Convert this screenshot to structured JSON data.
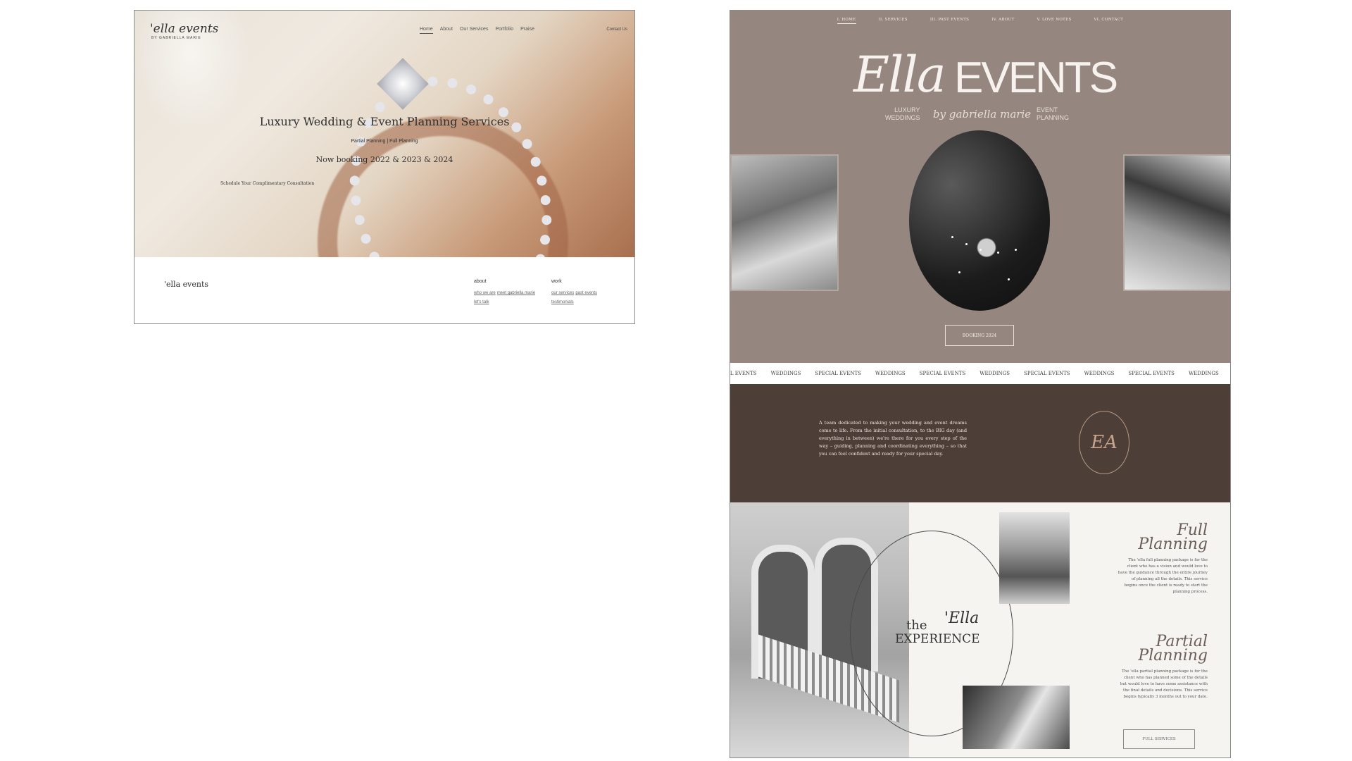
{
  "before": {
    "logo": "'ella events",
    "logo_sub": "BY GABRIELLA MARIE",
    "nav": [
      "Home",
      "About",
      "Our Services",
      "Portfolio",
      "Praise"
    ],
    "contact": "Contact Us",
    "headline": "Luxury Wedding & Event Planning Services",
    "subhead": "Partial Planning | Full Planning",
    "booking": "Now booking 2022 & 2023 & 2024",
    "cta": "Schedule Your Complimentary Consultation",
    "footer_logo": "'ella events",
    "footer_cols": [
      {
        "title": "about",
        "links": [
          "who we are",
          "meet gabriella marie",
          "let's talk"
        ]
      },
      {
        "title": "work",
        "links": [
          "our services",
          "past events",
          "testimonials"
        ]
      }
    ]
  },
  "after": {
    "nav": [
      "I. HOME",
      "II. SERVICES",
      "III. PAST EVENTS",
      "IV. ABOUT",
      "V. LOVE NOTES",
      "VI. CONTACT"
    ],
    "brand_script": "Ella",
    "brand_caps": "EVENTS",
    "tagline_left": [
      "LUXURY",
      "WEDDINGS"
    ],
    "tagline_script": "by gabriella marie",
    "tagline_right": [
      "EVENT",
      "PLANNING"
    ],
    "booking_button": "BOOKING 2024",
    "ticker": [
      "IAL EVENTS",
      "WEDDINGS",
      "SPECIAL EVENTS",
      "WEDDINGS",
      "SPECIAL EVENTS",
      "WEDDINGS",
      "SPECIAL EVENTS",
      "WEDDINGS",
      "SPECIAL EVENTS",
      "WEDDINGS"
    ],
    "intro": "A team dedicated to making your wedding and event dreams come to life. From the initial consultation, to the BIG day (and everything in between) we're there for you every step of the way – guiding, planning and coordinating everything – so that you can feel confident and ready for your special day.",
    "monogram": "EA",
    "experience_the": "the",
    "experience_script": "'Ella",
    "experience_word": "EXPERIENCE",
    "full_title": "Full Planning",
    "full_text": "The 'ella full planning package is for the client who has a vision and would love to have the guidance through the entire journey of planning all the details. This service begins once the client is ready to start the planning process.",
    "partial_title": "Partial Planning",
    "partial_text": "The 'ella partial planning package is for the client who has planned some of the details but would love to have some assistance with the final details and decisions. This service begins typically 3 months out to your date.",
    "full_services_button": "FULL SERVICES",
    "colors": {
      "mauve": "#958680",
      "espresso": "#4e3e38",
      "cream": "#f6f4f1"
    }
  }
}
